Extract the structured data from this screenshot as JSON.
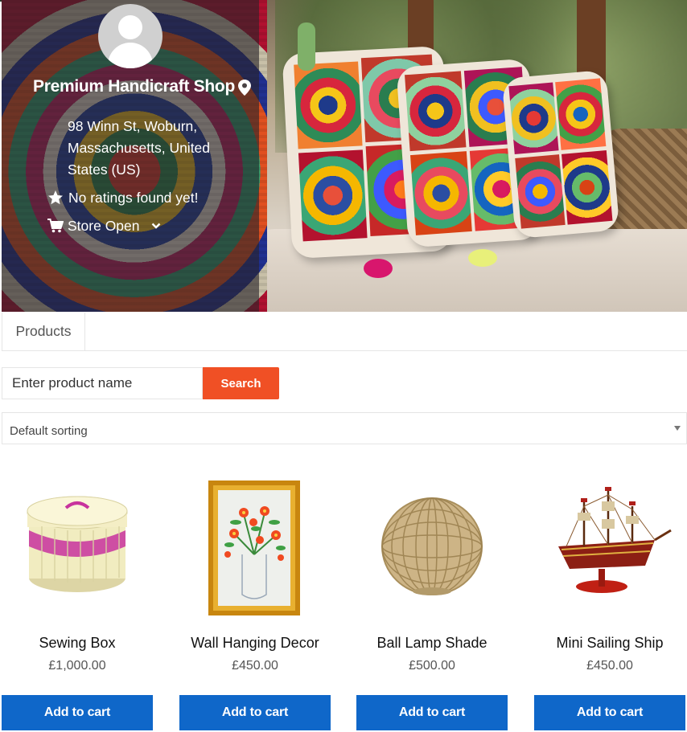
{
  "store": {
    "name": "Premium Handicraft Shop",
    "address": "98 Winn St, Woburn, Massachusetts, United States (US)",
    "rating_text": "No ratings found yet!",
    "status_text": "Store Open"
  },
  "tabs": [
    {
      "label": "Products"
    }
  ],
  "search": {
    "placeholder": "Enter product name",
    "button_label": "Search"
  },
  "sorting": {
    "selected": "Default sorting"
  },
  "products": [
    {
      "name": "Sewing Box",
      "price": "£1,000.00",
      "button": "Add to cart",
      "icon": "sewing-box-image"
    },
    {
      "name": "Wall Hanging Decor",
      "price": "£450.00",
      "button": "Add to cart",
      "icon": "wall-hanging-image"
    },
    {
      "name": "Ball Lamp Shade",
      "price": "£500.00",
      "button": "Add to cart",
      "icon": "lamp-shade-image"
    },
    {
      "name": "Mini Sailing Ship",
      "price": "£450.00",
      "button": "Add to cart",
      "icon": "sailing-ship-image"
    }
  ],
  "colors": {
    "search_button": "#f05025",
    "add_to_cart": "#0f67c9",
    "overlay": "#282428"
  }
}
